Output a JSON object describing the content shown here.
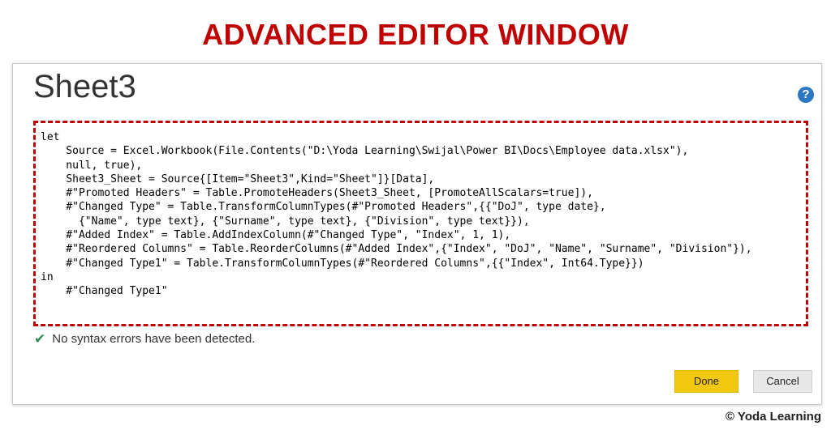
{
  "banner": "ADVANCED EDITOR WINDOW",
  "dialog": {
    "title": "Sheet3",
    "help_label": "?",
    "code": "let\n    Source = Excel.Workbook(File.Contents(\"D:\\Yoda Learning\\Swijal\\Power BI\\Docs\\Employee data.xlsx\"),\n    null, true),\n    Sheet3_Sheet = Source{[Item=\"Sheet3\",Kind=\"Sheet\"]}[Data],\n    #\"Promoted Headers\" = Table.PromoteHeaders(Sheet3_Sheet, [PromoteAllScalars=true]),\n    #\"Changed Type\" = Table.TransformColumnTypes(#\"Promoted Headers\",{{\"DoJ\", type date},\n      {\"Name\", type text}, {\"Surname\", type text}, {\"Division\", type text}}),\n    #\"Added Index\" = Table.AddIndexColumn(#\"Changed Type\", \"Index\", 1, 1),\n    #\"Reordered Columns\" = Table.ReorderColumns(#\"Added Index\",{\"Index\", \"DoJ\", \"Name\", \"Surname\", \"Division\"}),\n    #\"Changed Type1\" = Table.TransformColumnTypes(#\"Reordered Columns\",{{\"Index\", Int64.Type}})\nin\n    #\"Changed Type1\"",
    "status": {
      "icon": "check-icon",
      "text": "No syntax errors have been detected."
    },
    "buttons": {
      "done": "Done",
      "cancel": "Cancel"
    }
  },
  "copyright": "© Yoda Learning",
  "colors": {
    "banner": "#c00000",
    "highlight_border": "#c00000",
    "done_button": "#f2c811",
    "help_icon": "#2c78c2",
    "check": "#2e8b57"
  }
}
